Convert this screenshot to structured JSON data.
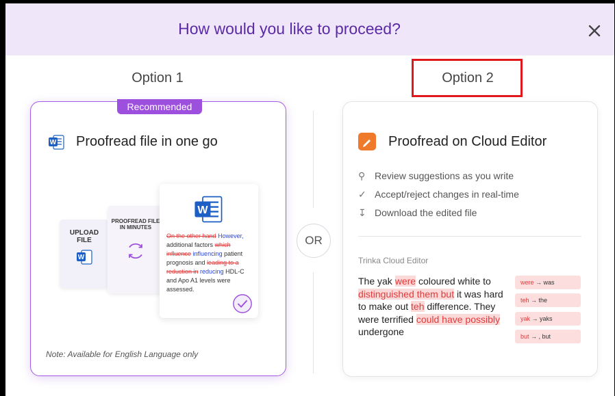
{
  "dialog": {
    "title": "How would you like to proceed?"
  },
  "option1": {
    "label": "Option 1",
    "badge": "Recommended",
    "title": "Proofread file in one go",
    "illustration": {
      "upload_label_1": "UPLOAD",
      "upload_label_2": "FILE",
      "proofread_label_1": "PROOFREAD FILE",
      "proofread_label_2": "IN MINUTES",
      "sample_struck_1": "On the other hand",
      "sample_insert_1": "However,",
      "sample_plain_1": "additional factors",
      "sample_struck_2": "which influence",
      "sample_insert_2": "influencing",
      "sample_plain_2": "patient prognosis and",
      "sample_struck_3": "leading to a reduction in",
      "sample_insert_3": "reducing",
      "sample_plain_3": "HDL-C and Apo A1 levels were assessed."
    },
    "note": "Note: Available for English Language only"
  },
  "divider": {
    "or_label": "OR"
  },
  "option2": {
    "label": "Option 2",
    "title": "Proofread on Cloud Editor",
    "features": [
      "Review suggestions as you write",
      "Accept/reject changes in real-time",
      "Download the edited file"
    ],
    "editor_label": "Trinka Cloud Editor",
    "editor_text": {
      "p1": "The yak",
      "h1": "were",
      "p2": "coloured white to",
      "h2": "distinguished them but",
      "p3": "it was hard to make out",
      "h3": "teh",
      "p4": "difference. They were terrified",
      "h4": "could have possibly",
      "p5": "undergone"
    },
    "suggestions": [
      {
        "from": "were",
        "to": "was"
      },
      {
        "from": "teh",
        "to": "the"
      },
      {
        "from": "yak",
        "to": "yaks"
      },
      {
        "from": "but",
        "to": ", but"
      }
    ]
  },
  "colors": {
    "accent": "#5a2aa6",
    "badge": "#9d4fdd",
    "highlight": "#e0181c",
    "cloud_icon": "#f07a2c"
  }
}
